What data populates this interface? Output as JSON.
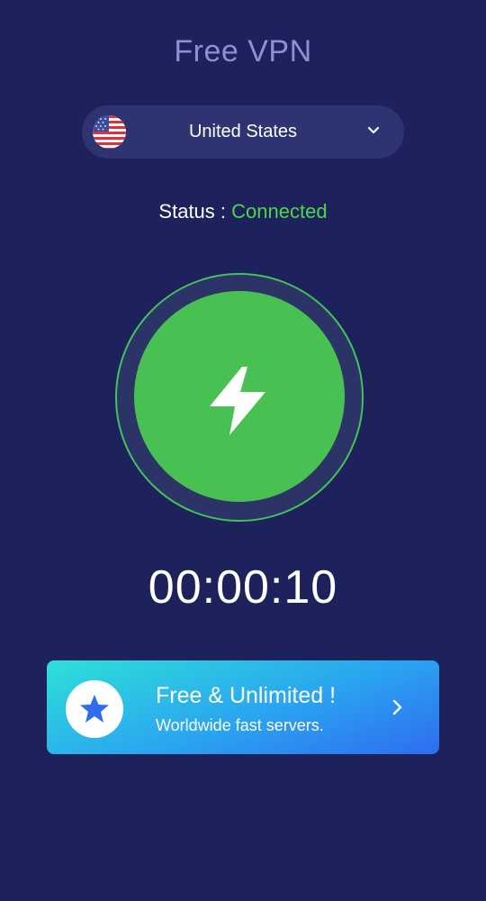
{
  "header": {
    "title": "Free VPN"
  },
  "country_selector": {
    "selected": "United States",
    "flag_icon": "us-flag-icon",
    "dropdown_icon": "chevron-down-icon"
  },
  "status": {
    "label": "Status : ",
    "value": "Connected",
    "value_color": "#4ed44a"
  },
  "connect_button": {
    "icon": "lightning-bolt-icon",
    "state": "connected",
    "color": "#49c152"
  },
  "timer": {
    "elapsed": "00:00:10"
  },
  "promo": {
    "title": "Free & Unlimited !",
    "subtitle": "Worldwide fast servers.",
    "icon": "star-icon",
    "arrow_icon": "chevron-right-icon"
  },
  "colors": {
    "background": "#1e225c",
    "accent_green": "#49c152",
    "title_color": "#8c90d6"
  }
}
